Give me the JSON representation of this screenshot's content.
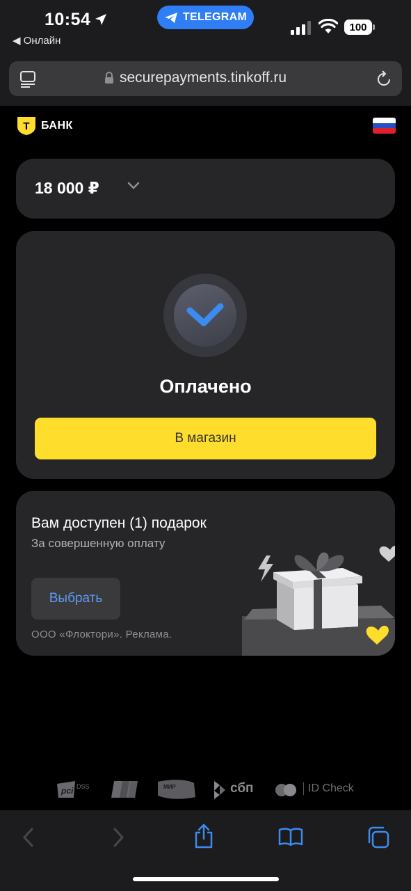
{
  "status_bar": {
    "time": "10:54",
    "back_app_label": "◀ Онлайн",
    "telegram_pill": "TELEGRAM",
    "battery_level": "100"
  },
  "browser": {
    "url": "securepayments.tinkoff.ru"
  },
  "header": {
    "bank_name": "БАНК",
    "logo_letter": "Т"
  },
  "amount": {
    "value": "18 000 ₽"
  },
  "payment_status": {
    "title": "Оплачено",
    "shop_button_label": "В магазин"
  },
  "gift": {
    "title": "Вам доступен (1) подарок",
    "subtitle": "За совершенную оплату",
    "choose_button_label": "Выбрать",
    "ad_note": "ООО «Флоктори». Реклама."
  },
  "payment_logos": {
    "pci_label": "DSS",
    "mir_label": "МИР",
    "sbp_label": "сбп",
    "id_check_label": "ID Check"
  },
  "colors": {
    "accent_yellow": "#ffdd2d",
    "link_blue": "#5c9bf5",
    "telegram_blue": "#2f7ef5",
    "card_bg": "#262628",
    "page_bg": "#000000"
  },
  "icons": {
    "location": "location-arrow-icon",
    "telegram": "telegram-plane-icon",
    "reader": "reader-mode-icon",
    "lock": "lock-icon",
    "reload": "reload-icon",
    "check": "checkmark-icon",
    "chevron": "chevron-down-icon",
    "share": "share-icon",
    "bookmarks": "book-icon",
    "tabs": "tabs-icon"
  }
}
